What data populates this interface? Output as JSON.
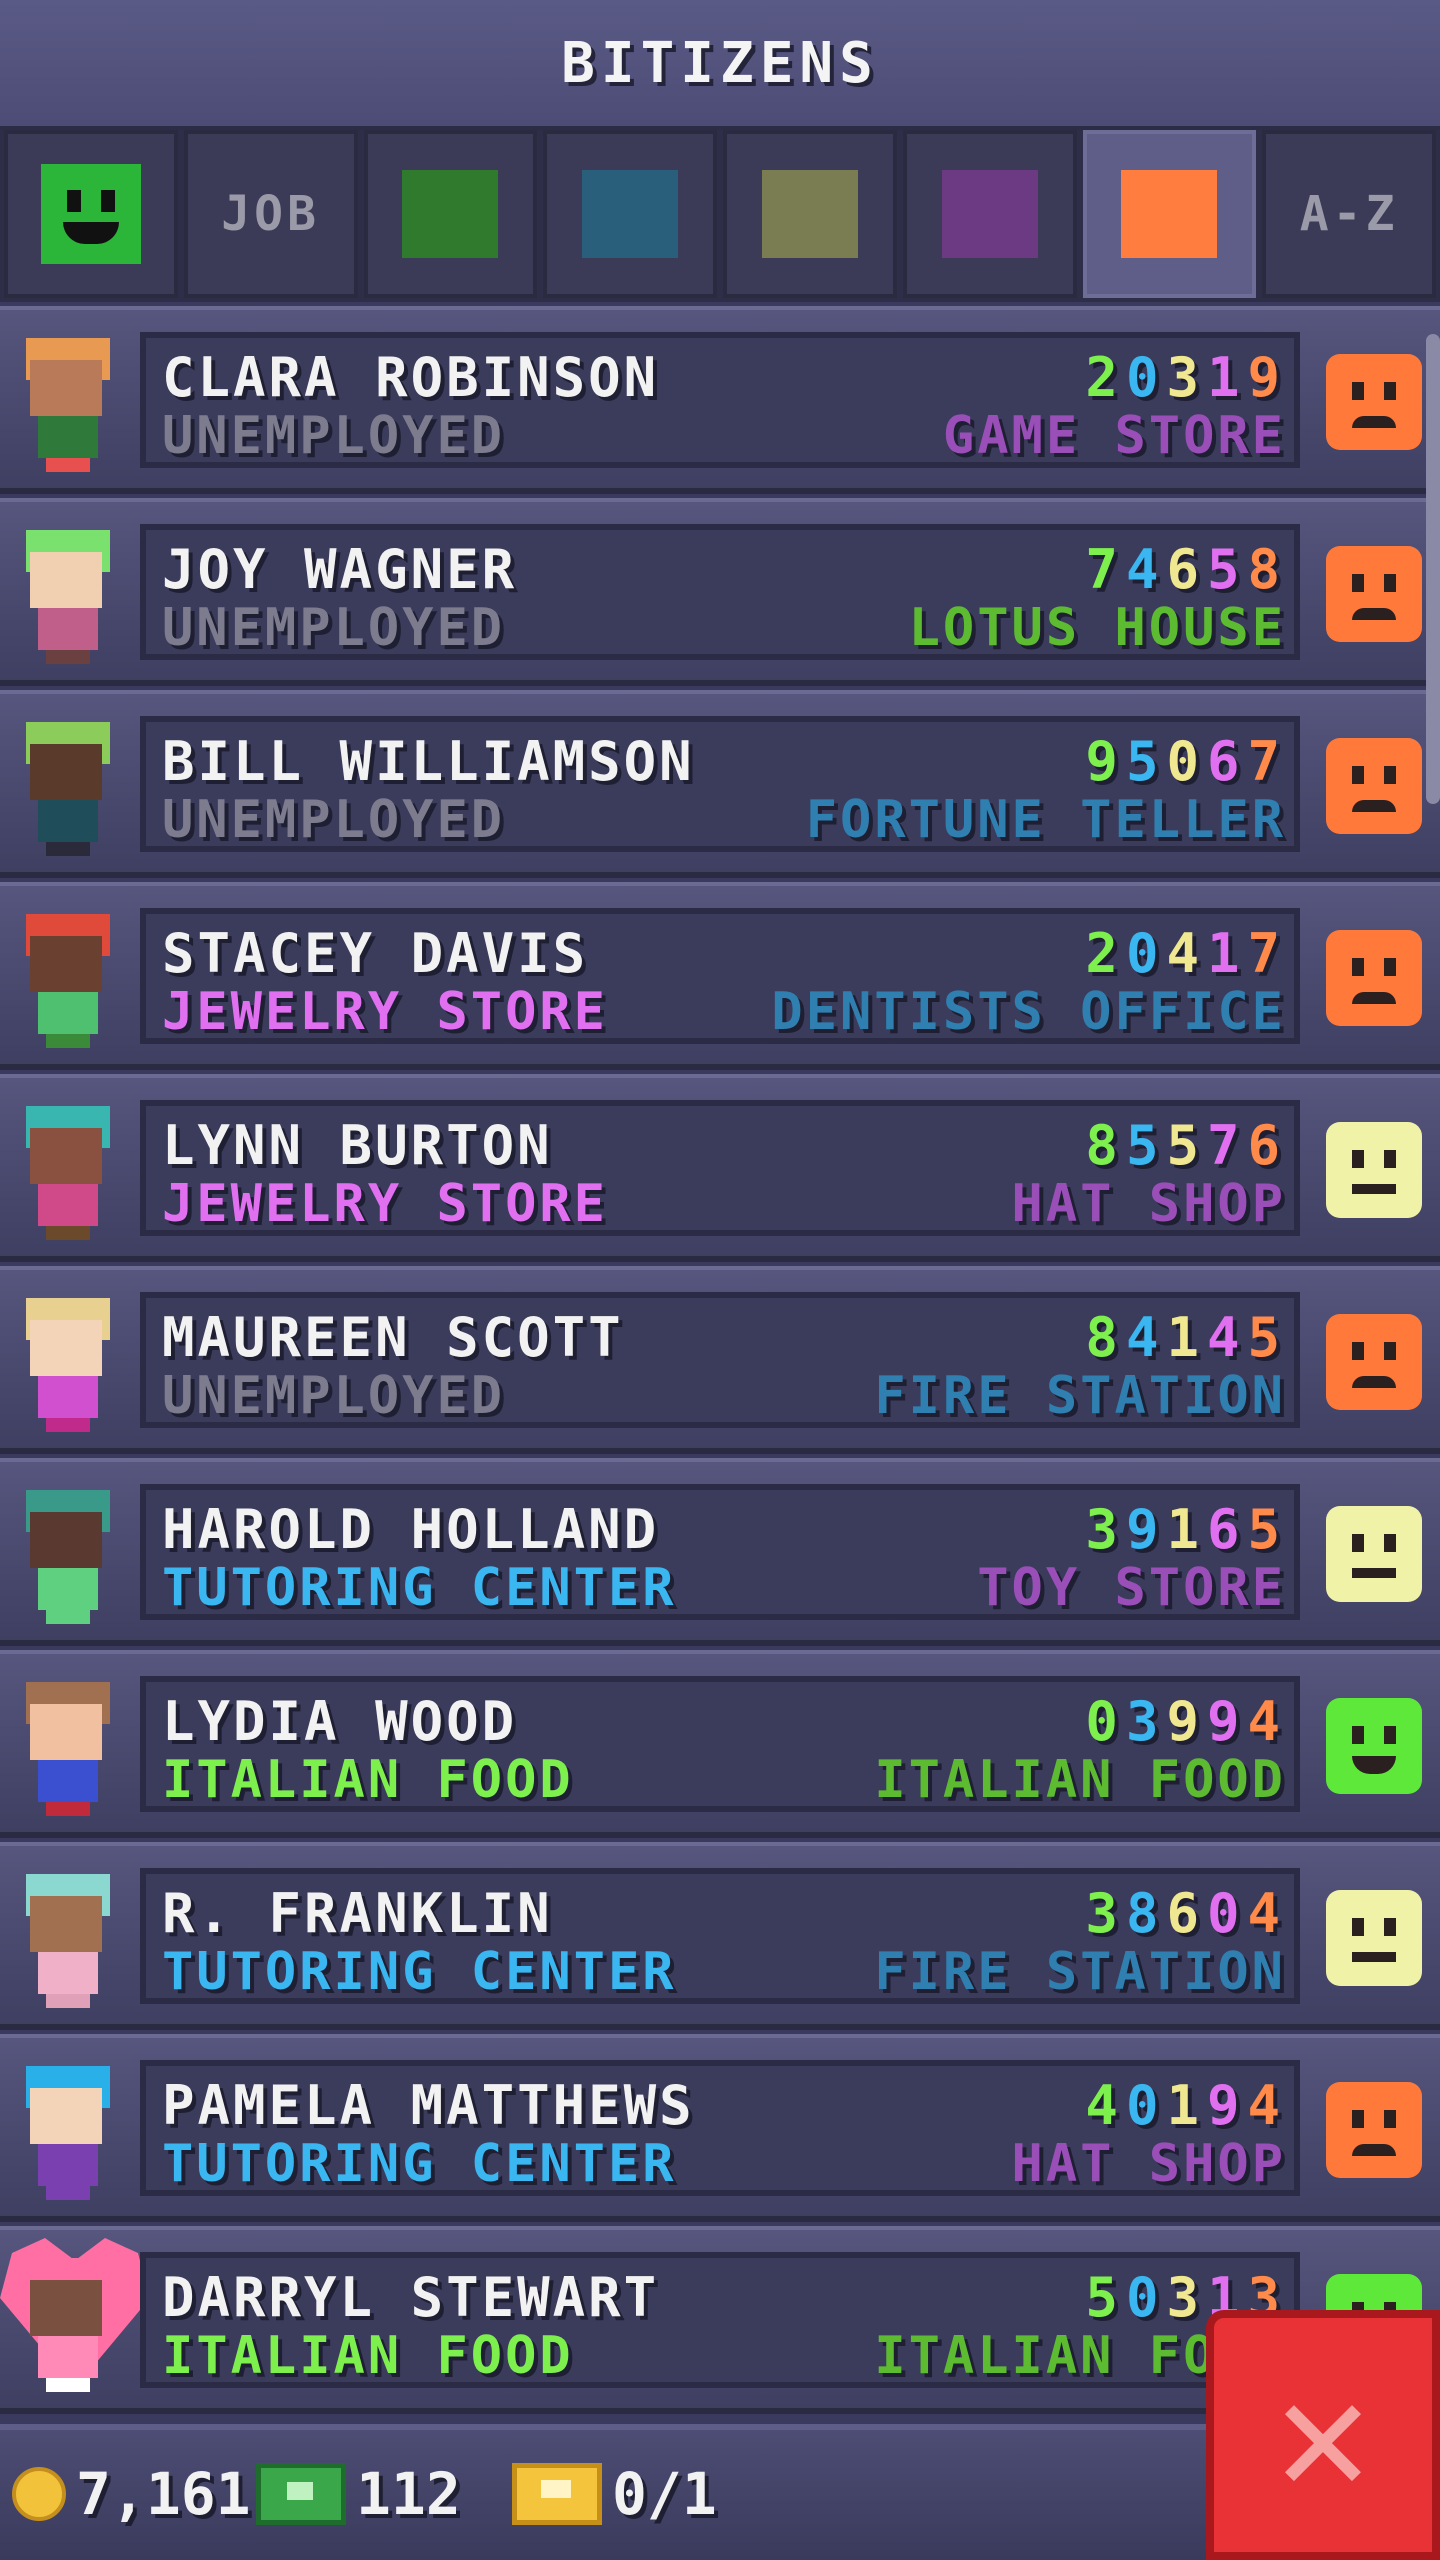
{
  "header": {
    "title": "BITIZENS"
  },
  "tabs": [
    {
      "id": "mood",
      "type": "face",
      "color": "#2bb63a"
    },
    {
      "id": "job",
      "type": "label",
      "label": "JOB"
    },
    {
      "id": "green",
      "type": "swatch",
      "color": "#2f7a2c"
    },
    {
      "id": "teal",
      "type": "swatch",
      "color": "#2a5f7b"
    },
    {
      "id": "olive",
      "type": "swatch",
      "color": "#7a7d52"
    },
    {
      "id": "purple",
      "type": "swatch",
      "color": "#6b3a82"
    },
    {
      "id": "orange",
      "type": "swatch",
      "color": "#ff7e3f",
      "active": true
    },
    {
      "id": "az",
      "type": "label",
      "label": "A-Z"
    }
  ],
  "digit_colors": [
    "#7ef04e",
    "#3ab6f0",
    "#f0e890",
    "#e070f0",
    "#ff8a4a"
  ],
  "bitizens": [
    {
      "name": "CLARA ROBINSON",
      "job": "UNEMPLOYED",
      "job_color": "#7c7c8e",
      "code": [
        "2",
        "0",
        "3",
        "1",
        "9"
      ],
      "dream": "GAME STORE",
      "dream_color": "#9a4fb8",
      "mood": "sad",
      "avatar": {
        "hair": "#e89a52",
        "skin": "#b97a5a",
        "body": "#2f7a3a",
        "legs": "#e85050"
      }
    },
    {
      "name": "JOY WAGNER",
      "job": "UNEMPLOYED",
      "job_color": "#7c7c8e",
      "code": [
        "7",
        "4",
        "6",
        "5",
        "8"
      ],
      "dream": "LOTUS HOUSE",
      "dream_color": "#5dbb32",
      "mood": "sad",
      "avatar": {
        "hair": "#7ae06e",
        "skin": "#f0d0b0",
        "body": "#c0608a",
        "legs": "#6a4040"
      }
    },
    {
      "name": "BILL WILLIAMSON",
      "job": "UNEMPLOYED",
      "job_color": "#7c7c8e",
      "code": [
        "9",
        "5",
        "0",
        "6",
        "7"
      ],
      "dream": "FORTUNE TELLER",
      "dream_color": "#2f7fb0",
      "mood": "sad",
      "avatar": {
        "hair": "#8ccc5a",
        "skin": "#5a3a2a",
        "body": "#1f4e5a",
        "legs": "#2a2a3a"
      }
    },
    {
      "name": "STACEY DAVIS",
      "job": "JEWELRY STORE",
      "job_color": "#e070f0",
      "code": [
        "2",
        "0",
        "4",
        "1",
        "7"
      ],
      "dream": "DENTISTS OFFICE",
      "dream_color": "#2f7fb0",
      "mood": "sad",
      "avatar": {
        "hair": "#e04a3a",
        "skin": "#6a4030",
        "body": "#4ec070",
        "legs": "#3a8a3a"
      }
    },
    {
      "name": "LYNN BURTON",
      "job": "JEWELRY STORE",
      "job_color": "#e070f0",
      "code": [
        "8",
        "5",
        "5",
        "7",
        "6"
      ],
      "dream": "HAT SHOP",
      "dream_color": "#9a4fb8",
      "mood": "neutral",
      "avatar": {
        "hair": "#3ab6b0",
        "skin": "#8a5040",
        "body": "#d04a8a",
        "legs": "#6a4a2a"
      }
    },
    {
      "name": "MAUREEN SCOTT",
      "job": "UNEMPLOYED",
      "job_color": "#7c7c8e",
      "code": [
        "8",
        "4",
        "1",
        "4",
        "5"
      ],
      "dream": "FIRE STATION",
      "dream_color": "#2f7fb0",
      "mood": "sad",
      "avatar": {
        "hair": "#e8d090",
        "skin": "#f4d4b8",
        "body": "#d050d0",
        "legs": "#c02a8a"
      }
    },
    {
      "name": "HAROLD HOLLAND",
      "job": "TUTORING CENTER",
      "job_color": "#3ab6f0",
      "code": [
        "3",
        "9",
        "1",
        "6",
        "5"
      ],
      "dream": "TOY STORE",
      "dream_color": "#9a4fb8",
      "mood": "neutral",
      "avatar": {
        "hair": "#3a9a8a",
        "skin": "#5a3a30",
        "body": "#5ed080",
        "legs": "#5ed080"
      }
    },
    {
      "name": "LYDIA WOOD",
      "job": "ITALIAN FOOD",
      "job_color": "#7ef04e",
      "code": [
        "0",
        "3",
        "9",
        "9",
        "4"
      ],
      "dream": "ITALIAN FOOD",
      "dream_color": "#5dbb32",
      "mood": "happy",
      "avatar": {
        "hair": "#a07050",
        "skin": "#f0c0a0",
        "body": "#3a50d0",
        "legs": "#c02a3a"
      }
    },
    {
      "name": "R. FRANKLIN",
      "job": "TUTORING CENTER",
      "job_color": "#3ab6f0",
      "code": [
        "3",
        "8",
        "6",
        "0",
        "4"
      ],
      "dream": "FIRE STATION",
      "dream_color": "#2f7fb0",
      "mood": "neutral",
      "avatar": {
        "hair": "#8ad8d0",
        "skin": "#a07050",
        "body": "#f0b0c8",
        "legs": "#e0a0b8"
      }
    },
    {
      "name": "PAMELA MATTHEWS",
      "job": "TUTORING CENTER",
      "job_color": "#3ab6f0",
      "code": [
        "4",
        "0",
        "1",
        "9",
        "4"
      ],
      "dream": "HAT SHOP",
      "dream_color": "#9a4fb8",
      "mood": "sad",
      "avatar": {
        "hair": "#2ab0e8",
        "skin": "#f4d4b8",
        "body": "#7a40b0",
        "legs": "#7a40b0"
      }
    },
    {
      "name": "DARRYL STEWART",
      "job": "ITALIAN FOOD",
      "job_color": "#7ef04e",
      "code": [
        "5",
        "0",
        "3",
        "1",
        "3"
      ],
      "dream": "ITALIAN FOOD",
      "dream_color": "#5dbb32",
      "mood": "happy",
      "heart": true,
      "avatar": {
        "hair": "#ff6fa3",
        "skin": "#7a5040",
        "body": "#ff8ab8",
        "legs": "#ffffff"
      }
    }
  ],
  "mood_colors": {
    "sad": "#ff7a3a",
    "neutral": "#f0f2a8",
    "happy": "#5ee83a"
  },
  "footer": {
    "coins": "7,161",
    "bux": "112",
    "tickets": "0/1"
  },
  "close_icon": "close-icon"
}
